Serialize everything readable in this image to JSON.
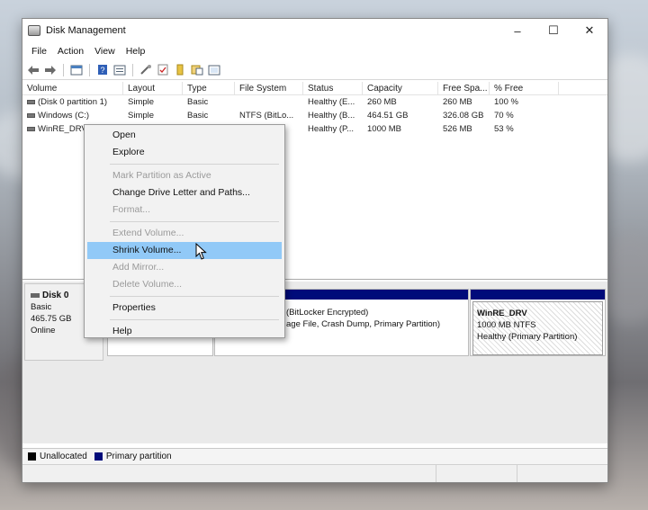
{
  "window": {
    "title": "Disk Management",
    "minimize": "–",
    "maximize": "☐",
    "close": "✕"
  },
  "menubar": [
    "File",
    "Action",
    "View",
    "Help"
  ],
  "toolbar": {
    "icons": [
      "back-arrow-icon",
      "forward-arrow-icon",
      "show-hide-console-icon",
      "properties-icon",
      "help-icon",
      "refresh-icon",
      "rescan-icon",
      "connect-icon",
      "settings-icon",
      "disk-list-icon"
    ]
  },
  "volumes": {
    "columns": [
      "Volume",
      "Layout",
      "Type",
      "File System",
      "Status",
      "Capacity",
      "Free Spa...",
      "% Free"
    ],
    "rows": [
      [
        "(Disk 0 partition 1)",
        "Simple",
        "Basic",
        "",
        "Healthy (E...",
        "260 MB",
        "260 MB",
        "100 %"
      ],
      [
        "Windows (C:)",
        "Simple",
        "Basic",
        "NTFS (BitLo...",
        "Healthy (B...",
        "464.51 GB",
        "326.08 GB",
        "70 %"
      ],
      [
        "WinRE_DRV",
        "",
        "",
        "",
        "Healthy (P...",
        "1000 MB",
        "526 MB",
        "53 %"
      ]
    ]
  },
  "disk": {
    "name": "Disk 0",
    "type": "Basic",
    "size": "465.75 GB",
    "status": "Online",
    "partitions": [
      {
        "line1": "",
        "line2": ""
      },
      {
        "line1": "(BitLocker Encrypted)",
        "line2": "age File, Crash Dump, Primary Partition)"
      },
      {
        "title": "WinRE_DRV",
        "line1": "1000 MB NTFS",
        "line2": "Healthy (Primary Partition)"
      }
    ]
  },
  "legend": {
    "unallocated": "Unallocated",
    "primary": "Primary partition",
    "unallocated_color": "#000000",
    "primary_color": "#000b7a"
  },
  "context_menu": {
    "items": [
      {
        "label": "Open",
        "disabled": false
      },
      {
        "label": "Explore",
        "disabled": false
      },
      {
        "label": "Mark Partition as Active",
        "disabled": true
      },
      {
        "label": "Change Drive Letter and Paths...",
        "disabled": false
      },
      {
        "label": "Format...",
        "disabled": true
      },
      {
        "label": "Extend Volume...",
        "disabled": true
      },
      {
        "label": "Shrink Volume...",
        "disabled": false,
        "highlighted": true
      },
      {
        "label": "Add Mirror...",
        "disabled": true
      },
      {
        "label": "Delete Volume...",
        "disabled": true
      },
      {
        "label": "Properties",
        "disabled": false
      },
      {
        "label": "Help",
        "disabled": false
      }
    ]
  },
  "colors": {
    "highlight": "#91c9f7",
    "primary_bar": "#000b7a"
  }
}
